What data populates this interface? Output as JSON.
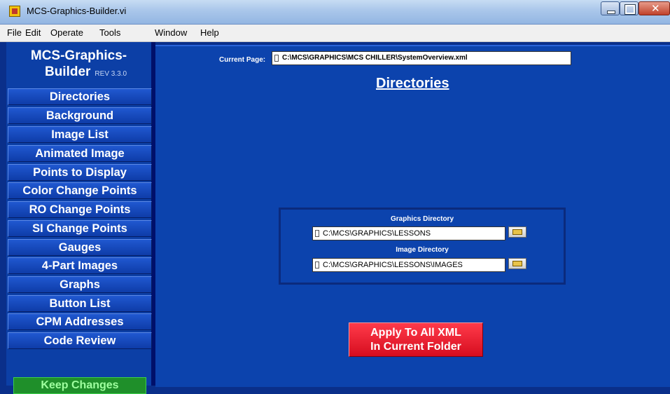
{
  "window": {
    "title": "MCS-Graphics-Builder.vi"
  },
  "menu": [
    "File",
    "Edit",
    "Operate",
    "Tools",
    "Window",
    "Help"
  ],
  "sidebar": {
    "app_name_line1": "MCS-Graphics-",
    "app_name_line2": "Builder",
    "revision": "REV 3.3.0",
    "items": [
      "Directories",
      "Background",
      "Image List",
      "Animated Image",
      "Points to Display",
      "Color Change Points",
      "RO Change Points",
      "SI Change Points",
      "Gauges",
      "4-Part Images",
      "Graphs",
      "Button List",
      "CPM Addresses",
      "Code Review"
    ],
    "keep_button": "Keep Changes"
  },
  "main": {
    "current_page_label": "Current Page:",
    "current_page_value": "C:\\MCS\\GRAPHICS\\MCS CHILLER\\SystemOverview.xml",
    "section_title": "Directories",
    "graphics_dir_label": "Graphics Directory",
    "graphics_dir_value": "C:\\MCS\\GRAPHICS\\LESSONS",
    "image_dir_label": "Image Directory",
    "image_dir_value": "C:\\MCS\\GRAPHICS\\LESSONS\\IMAGES",
    "apply_line1": "Apply To All XML",
    "apply_line2": "In Current Folder"
  }
}
